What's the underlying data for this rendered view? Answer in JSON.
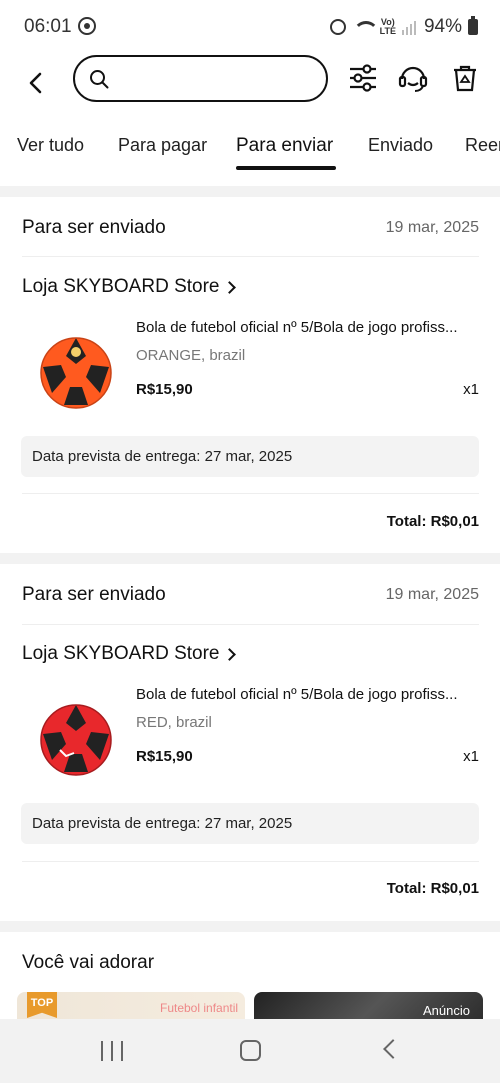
{
  "status_bar": {
    "time": "06:01",
    "battery": "94%",
    "network_label": "VoLTE"
  },
  "search": {
    "placeholder": "",
    "value": ""
  },
  "tabs": [
    {
      "label": "Ver tudo"
    },
    {
      "label": "Para pagar"
    },
    {
      "label": "Para enviar",
      "active": true
    },
    {
      "label": "Enviado"
    },
    {
      "label": "Reem"
    }
  ],
  "orders": [
    {
      "status": "Para ser enviado",
      "date": "19 mar, 2025",
      "store": "Loja SKYBOARD Store",
      "product_title": "Bola de futebol oficial nº 5/Bola de jogo profiss...",
      "variant": "ORANGE, brazil",
      "price": "R$15,90",
      "quantity": "x1",
      "delivery": "Data prevista de entrega: 27 mar, 2025",
      "total": "Total: R$0,01",
      "ball_color": "#ff5a1f"
    },
    {
      "status": "Para ser enviado",
      "date": "19 mar, 2025",
      "store": "Loja SKYBOARD Store",
      "product_title": "Bola de futebol oficial nº 5/Bola de jogo profiss...",
      "variant": "RED, brazil",
      "price": "R$15,90",
      "quantity": "x1",
      "delivery": "Data prevista de entrega: 27 mar, 2025",
      "total": "Total: R$0,01",
      "ball_color": "#e8282c"
    }
  ],
  "recommend": {
    "title": "Você vai adorar",
    "left_badge": "TOP",
    "left_caption": "Futebol infantil",
    "right_badge": "Anúncio"
  },
  "icons": {
    "back": "arrow-left-icon",
    "search": "search-icon",
    "filter": "sliders-icon",
    "support": "headset-icon",
    "trash": "recycle-trash-icon"
  },
  "colors": {
    "text": "#111111",
    "muted": "#777777",
    "page_bg": "#f2f2f2",
    "delivery_bg": "#f3f3f3"
  }
}
